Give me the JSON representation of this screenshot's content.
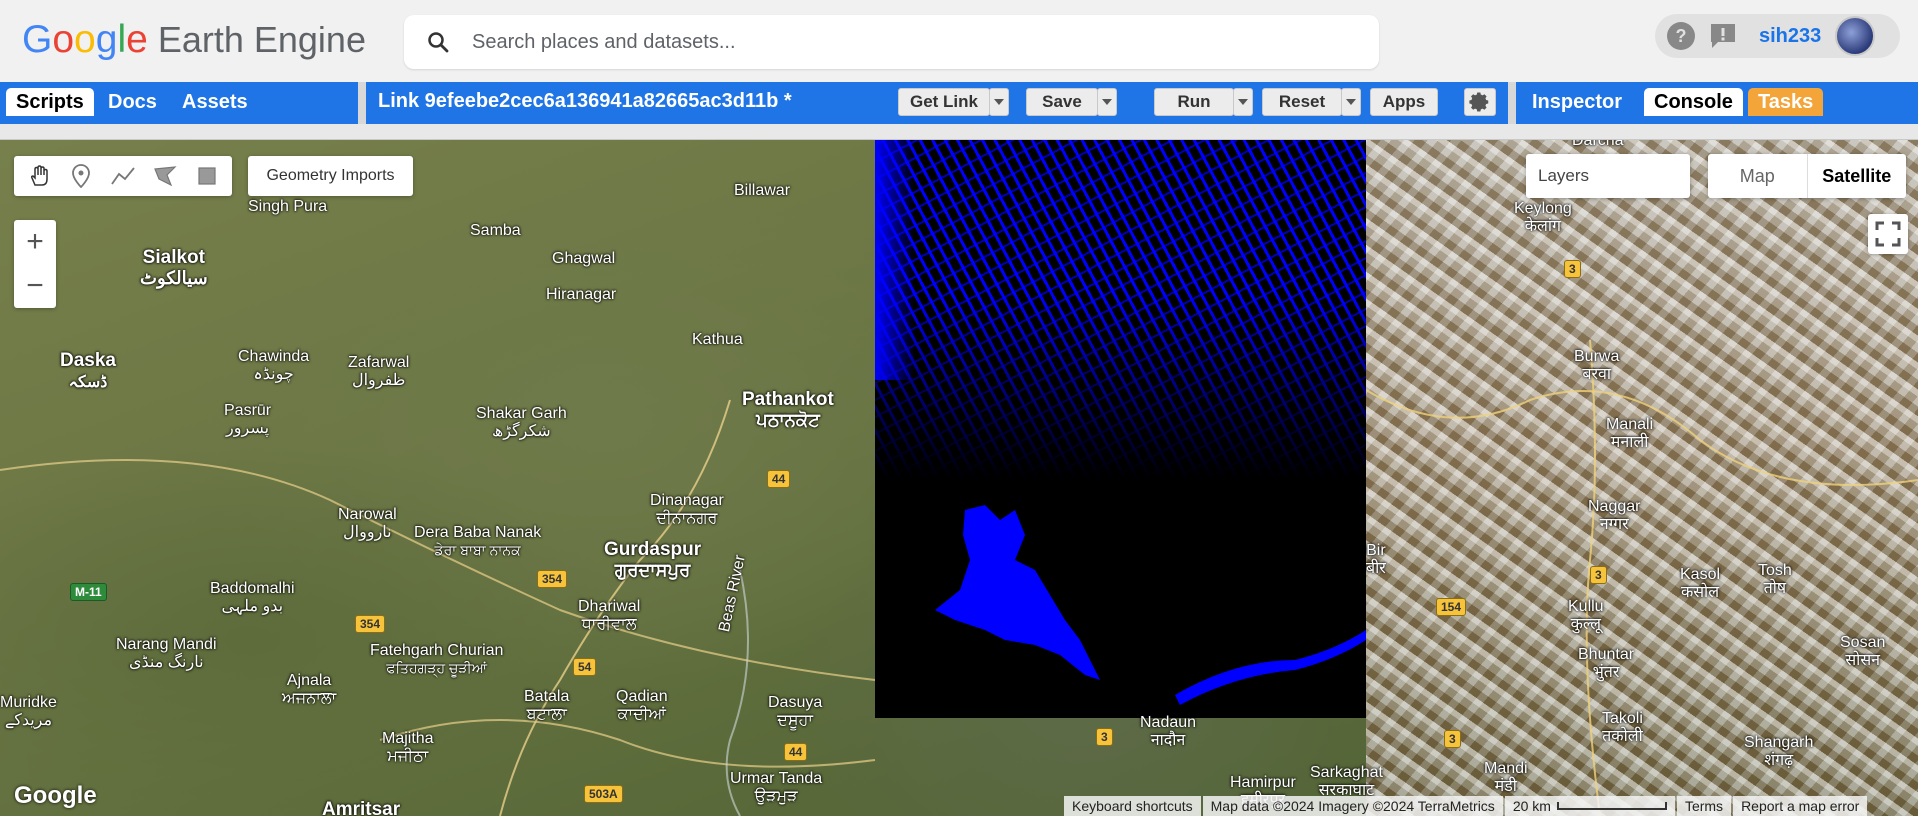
{
  "header": {
    "logo_google": [
      "G",
      "o",
      "o",
      "g",
      "l",
      "e"
    ],
    "logo_product": "Earth Engine",
    "search_placeholder": "Search places and datasets...",
    "user_name": "sih233"
  },
  "left_tabs": [
    "Scripts",
    "Docs",
    "Assets"
  ],
  "script_title": "Link 9efeebe2cec6a136941a82665ac3d11b *",
  "buttons": {
    "get_link": "Get Link",
    "save": "Save",
    "run": "Run",
    "reset": "Reset",
    "apps": "Apps"
  },
  "right_tabs": [
    "Inspector",
    "Console",
    "Tasks"
  ],
  "map": {
    "geometry_imports": "Geometry Imports",
    "layers": "Layers",
    "map_type": [
      "Map",
      "Satellite"
    ],
    "zoom_in": "+",
    "zoom_out": "−",
    "watermark": "Google",
    "attribution": {
      "shortcuts": "Keyboard shortcuts",
      "data": "Map data ©2024 Imagery ©2024 TerraMetrics",
      "scale": "20 km",
      "terms": "Terms",
      "report": "Report a map error"
    },
    "places": [
      {
        "name": "Sialkot",
        "sub": "سیالکوٹ"
      },
      {
        "name": "Daska",
        "sub": "ڈسکہ"
      },
      {
        "name": "Pathankot",
        "sub": "ਪਠਾਨਕੋਟ"
      },
      {
        "name": "Gurdaspur",
        "sub": "ਗੁਰਦਾਸਪੁਰ"
      },
      {
        "name": "Billawar",
        "sub": ""
      },
      {
        "name": "Singh Pura",
        "sub": ""
      },
      {
        "name": "Samba",
        "sub": ""
      },
      {
        "name": "Ghagwal",
        "sub": ""
      },
      {
        "name": "Hiranagar",
        "sub": ""
      },
      {
        "name": "Kathua",
        "sub": ""
      },
      {
        "name": "Chawinda",
        "sub": "چونڈہ"
      },
      {
        "name": "Zafarwal",
        "sub": "ظفروال"
      },
      {
        "name": "Pasrūr",
        "sub": "پسرور"
      },
      {
        "name": "Shakar Garh",
        "sub": "شکرگڑھ"
      },
      {
        "name": "Narowal",
        "sub": "نارووال"
      },
      {
        "name": "Dera Baba Nanak",
        "sub": "ਡੇਰਾ ਬਾਬਾ ਨਾਨਕ"
      },
      {
        "name": "Dinanagar",
        "sub": "ਦੀਨਾਨਗਰ"
      },
      {
        "name": "Baddomalhi",
        "sub": "بدو ملہی"
      },
      {
        "name": "Dhariwal",
        "sub": "ਧਾਰੀਵਾਲ"
      },
      {
        "name": "Narang Mandi",
        "sub": "نارنگ منڈی"
      },
      {
        "name": "Fatehgarh Churian",
        "sub": "ਫਤਿਹਗੜ੍ਹ ਚੂੜੀਆਂ"
      },
      {
        "name": "Ajnala",
        "sub": "ਅਜਨਾਲਾ"
      },
      {
        "name": "Batala",
        "sub": "ਬਟਾਲਾ"
      },
      {
        "name": "Qadian",
        "sub": "ਕਾਦੀਆਂ"
      },
      {
        "name": "Dasuya",
        "sub": "ਦਸੂਹਾ"
      },
      {
        "name": "Majitha",
        "sub": "ਮਜੀਠਾ"
      },
      {
        "name": "Urmar Tanda",
        "sub": "ਉੜਮੁੜ"
      },
      {
        "name": "Amritsar",
        "sub": ""
      },
      {
        "name": "Muridke",
        "sub": "مریدکے"
      },
      {
        "name": "Keylong",
        "sub": "केलांग"
      },
      {
        "name": "Burwa",
        "sub": "बरवा"
      },
      {
        "name": "Manali",
        "sub": "मनाली"
      },
      {
        "name": "Naggar",
        "sub": "नग्गर"
      },
      {
        "name": "Kasol",
        "sub": "कसोल"
      },
      {
        "name": "Tosh",
        "sub": "तोष"
      },
      {
        "name": "Kullu",
        "sub": "कुल्लू"
      },
      {
        "name": "Bhuntar",
        "sub": "भुंतर"
      },
      {
        "name": "Sosan",
        "sub": "सोसन"
      },
      {
        "name": "Takoli",
        "sub": "तकोली"
      },
      {
        "name": "Shangarh",
        "sub": "शंगढ़"
      },
      {
        "name": "Mandi",
        "sub": "मंडी"
      },
      {
        "name": "Sarkaghat",
        "sub": "सरकाघाट"
      },
      {
        "name": "Hamirpur",
        "sub": "हमीरपुर"
      },
      {
        "name": "Nadaun",
        "sub": "नादौन"
      },
      {
        "name": "Bir",
        "sub": "बीर"
      },
      {
        "name": "Darcha",
        "sub": ""
      },
      {
        "name": "Beas River",
        "sub": ""
      }
    ]
  },
  "colors": {
    "toolbar_blue": "#1f74e6",
    "tasks_orange": "#f4a53a",
    "overlay_blue": "#0000ff"
  }
}
